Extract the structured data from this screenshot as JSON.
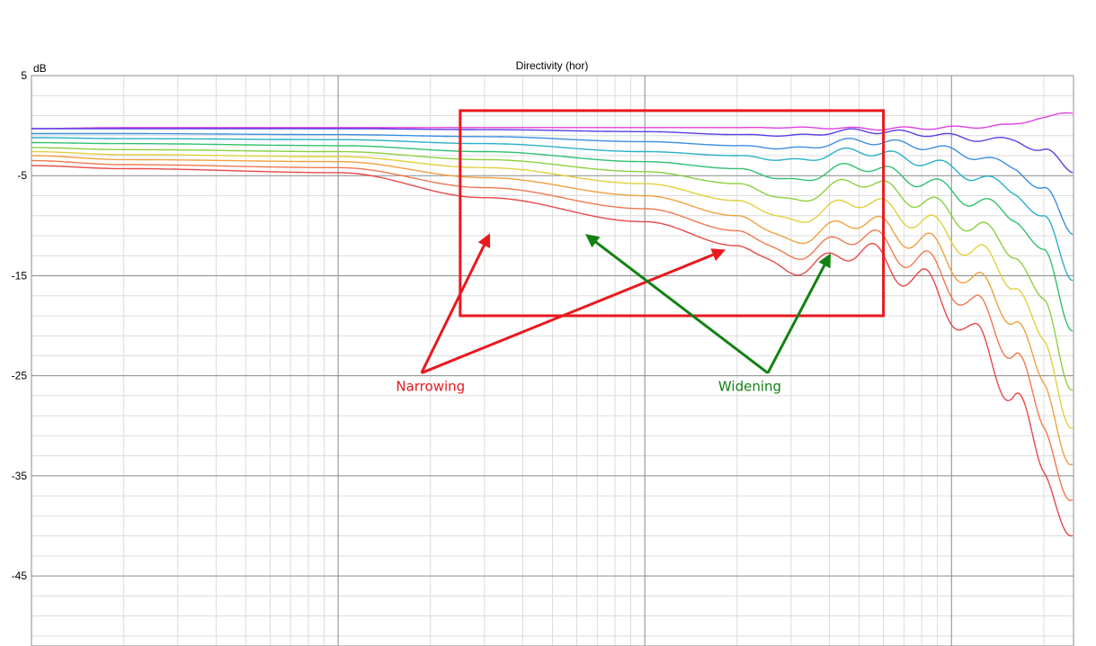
{
  "chart_data": {
    "type": "line",
    "title": "Directivity (hor)",
    "ylabel": "dB",
    "ylim": [
      -52,
      5
    ],
    "xscale": "log",
    "xlim": [
      10,
      25000
    ],
    "yticks": [
      5,
      -5,
      -15,
      -25,
      -35,
      -45
    ],
    "ytick_labels": [
      "5",
      "-5",
      "-15",
      "-25",
      "-35",
      "-45"
    ],
    "grid": true,
    "legend": "none",
    "highlight_box": {
      "x": [
        250,
        6000
      ],
      "y": [
        -19,
        1.5
      ],
      "color": "#e8191e"
    },
    "annotations": [
      {
        "text": "Narrowing",
        "color": "#e8191e",
        "anchor": [
          200,
          -24
        ],
        "arrows_to": [
          [
            310,
            -11
          ],
          [
            1800,
            -12.5
          ]
        ]
      },
      {
        "text": "Widening",
        "color": "#138113",
        "anchor": [
          2200,
          -24
        ],
        "arrows_to": [
          [
            650,
            -11
          ],
          [
            4000,
            -13
          ]
        ]
      }
    ],
    "series": [
      {
        "color": "#e040e0",
        "freq": [
          10,
          20,
          100,
          300,
          1000,
          3000,
          6000,
          10000,
          15000,
          20000,
          25000
        ],
        "values": [
          -0.3,
          -0.2,
          -0.2,
          -0.2,
          -0.2,
          -0.2,
          -0.3,
          -0.2,
          0.0,
          0.8,
          1.3
        ]
      },
      {
        "color": "#5a3ee8",
        "freq": [
          10,
          20,
          100,
          300,
          1000,
          2000,
          3000,
          5000,
          8000,
          12000,
          16000,
          20000,
          25000
        ],
        "values": [
          -0.3,
          -0.3,
          -0.3,
          -0.4,
          -0.6,
          -0.9,
          -1.0,
          -0.5,
          -0.8,
          -1.3,
          -1.5,
          -2.5,
          -4.5
        ]
      },
      {
        "color": "#3c8ee0",
        "freq": [
          10,
          20,
          100,
          300,
          1000,
          2000,
          3000,
          5000,
          8000,
          12000,
          16000,
          20000,
          25000
        ],
        "values": [
          -0.8,
          -0.8,
          -0.9,
          -1.1,
          -1.6,
          -2.0,
          -2.3,
          -1.5,
          -2.0,
          -3.0,
          -4.2,
          -6.5,
          -10.5
        ]
      },
      {
        "color": "#2ab0c8",
        "freq": [
          10,
          20,
          100,
          300,
          1000,
          2000,
          3000,
          5000,
          8000,
          12000,
          16000,
          20000,
          25000
        ],
        "values": [
          -1.2,
          -1.3,
          -1.4,
          -1.8,
          -2.6,
          -3.0,
          -3.5,
          -2.5,
          -3.5,
          -5.0,
          -6.5,
          -9.5,
          -15.0
        ]
      },
      {
        "color": "#30c070",
        "freq": [
          10,
          20,
          100,
          300,
          1000,
          2000,
          3000,
          5000,
          8000,
          12000,
          16000,
          20000,
          25000
        ],
        "values": [
          -1.7,
          -1.8,
          -2.0,
          -2.6,
          -3.6,
          -4.3,
          -5.5,
          -4.0,
          -5.5,
          -7.5,
          -9.0,
          -13.0,
          -20.0
        ]
      },
      {
        "color": "#8cd040",
        "freq": [
          10,
          20,
          100,
          300,
          1000,
          2000,
          3000,
          5000,
          8000,
          12000,
          16000,
          20000,
          25000
        ],
        "values": [
          -2.2,
          -2.4,
          -2.6,
          -3.4,
          -4.6,
          -5.8,
          -7.5,
          -5.5,
          -7.5,
          -10.0,
          -12.5,
          -18.0,
          -26.0
        ]
      },
      {
        "color": "#e0d040",
        "freq": [
          10,
          20,
          100,
          300,
          1000,
          2000,
          3000,
          5000,
          8000,
          12000,
          16000,
          20000,
          25000
        ],
        "values": [
          -2.6,
          -2.9,
          -3.1,
          -4.2,
          -5.8,
          -7.5,
          -9.5,
          -7.5,
          -9.5,
          -12.5,
          -15.5,
          -22.0,
          -30.0
        ]
      },
      {
        "color": "#f0a040",
        "freq": [
          10,
          20,
          100,
          300,
          1000,
          2000,
          3000,
          5000,
          8000,
          12000,
          16000,
          20000,
          25000
        ],
        "values": [
          -3.0,
          -3.4,
          -3.6,
          -5.2,
          -7.0,
          -9.0,
          -11.5,
          -9.5,
          -11.5,
          -15.5,
          -19.0,
          -26.0,
          -34.0
        ]
      },
      {
        "color": "#f07850",
        "freq": [
          10,
          20,
          100,
          300,
          1000,
          2000,
          3000,
          5000,
          8000,
          12000,
          16000,
          20000,
          25000
        ],
        "values": [
          -3.5,
          -3.9,
          -4.2,
          -6.2,
          -8.3,
          -10.5,
          -13.0,
          -11.0,
          -13.5,
          -18.0,
          -22.5,
          -30.0,
          -38.0
        ]
      },
      {
        "color": "#e84848",
        "freq": [
          10,
          20,
          100,
          300,
          1000,
          2000,
          3000,
          5000,
          8000,
          12000,
          16000,
          20000,
          25000
        ],
        "values": [
          -4.0,
          -4.3,
          -4.7,
          -7.2,
          -9.6,
          -12.0,
          -14.5,
          -12.5,
          -15.5,
          -21.0,
          -27.0,
          -34.0,
          -42.0
        ]
      }
    ]
  }
}
